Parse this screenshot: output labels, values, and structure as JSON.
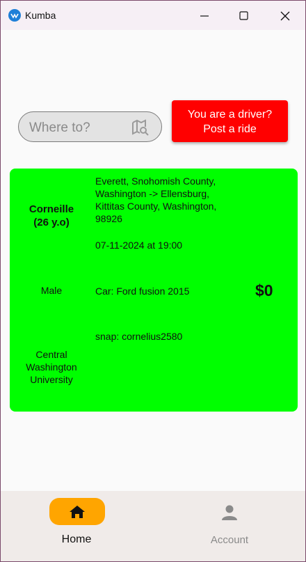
{
  "window": {
    "title": "Kumba",
    "icons": [
      "kumba-logo-icon",
      "minimize-icon",
      "maximize-icon",
      "close-icon"
    ]
  },
  "search": {
    "placeholder": "Where to?",
    "icon": "map-search-icon"
  },
  "driver_button": {
    "line1": "You are a driver?",
    "line2": "Post a ride"
  },
  "ride": {
    "name": "Corneille",
    "age": "(26 y.o)",
    "gender": "Male",
    "school_lines": [
      "Central",
      "Washington",
      "University"
    ],
    "route_lines": [
      "Everett, Snohomish County,",
      "Washington -> Ellensburg,",
      "Kittitas County, Washington,",
      "98926"
    ],
    "datetime": "07-11-2024 at 19:00",
    "car": "Car: Ford fusion 2015",
    "snap": "snap: cornelius2580",
    "price": "$0"
  },
  "nav": {
    "home_label": "Home",
    "account_label": "Account",
    "home_icon": "home-icon",
    "account_icon": "account-icon"
  },
  "colors": {
    "driver_button": "#ff0000",
    "ride_card": "#00ff00",
    "home_pill": "#ffa500"
  }
}
